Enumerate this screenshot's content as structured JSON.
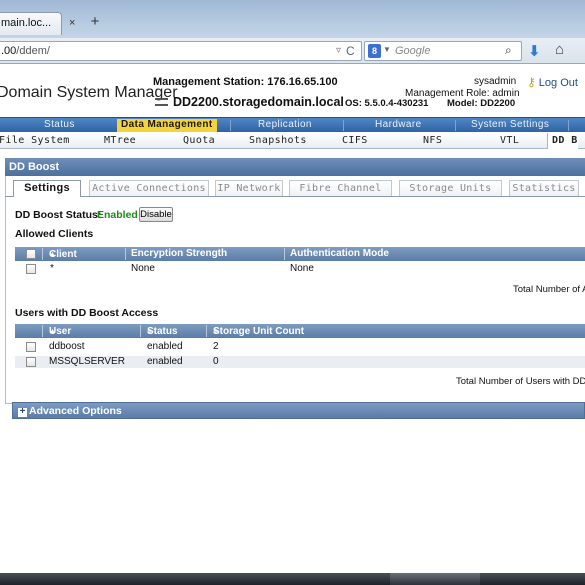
{
  "browser": {
    "tab_title": "main.loc...",
    "tab_close": "×",
    "new_tab": "+",
    "url_host": ".00",
    "url_path": "/ddem/",
    "url_arrow": "▿",
    "reload": "C",
    "search_engine_letter": "8",
    "search_placeholder": "Google",
    "search_go": "⌕",
    "download_icon": "⬇",
    "home_icon": "⌂"
  },
  "header": {
    "app_title": "Domain System Manager",
    "management_station": "Management Station: 176.16.65.100",
    "hostname": "DD2200.storagedomain.local",
    "os": "OS: 5.5.0.4-430231",
    "model": "Model: DD2200",
    "user": "sysadmin",
    "role": "Management Role: admin",
    "logout": "Log Out"
  },
  "main_nav": {
    "items": [
      "Status",
      "Data Management",
      "Replication",
      "Hardware",
      "System Settings"
    ],
    "active": "Data Management"
  },
  "sub_nav": {
    "items": [
      "File System",
      "MTree",
      "Quota",
      "Snapshots",
      "CIFS",
      "NFS",
      "VTL",
      "DD B"
    ],
    "active": "DD B"
  },
  "section": {
    "title": "DD Boost"
  },
  "content_tabs": {
    "items": [
      "Settings",
      "Active Connections",
      "IP Network",
      "Fibre Channel",
      "Storage Units",
      "Statistics"
    ],
    "active": "Settings"
  },
  "settings": {
    "status_label": "DD Boost Status:",
    "status_value": "Enabled",
    "disable_button": "Disable",
    "allowed_clients_heading": "Allowed Clients",
    "clients_columns": [
      "Client",
      "Encryption Strength",
      "Authentication Mode"
    ],
    "clients_sort_indicator": "▲",
    "clients_rows": [
      {
        "client": "*",
        "encryption": "None",
        "auth": "None"
      }
    ],
    "clients_total": "Total Number of A",
    "users_heading": "Users with DD Boost Access",
    "users_columns": [
      "User",
      "Status",
      "Storage Unit Count"
    ],
    "users_sort_indicator": "▲",
    "users_sort_both": "◆",
    "users_rows": [
      {
        "user": "ddboost",
        "status": "enabled",
        "count": "2"
      },
      {
        "user": "MSSQLSERVER",
        "status": "enabled",
        "count": "0"
      }
    ],
    "users_total": "Total Number of Users with DD",
    "advanced_options": "Advanced Options",
    "advanced_plus": "+"
  },
  "colors": {
    "nav_blue": "#2f64a5",
    "active_tab_yellow": "#f5d33a",
    "enabled_green": "#1e8a1e",
    "section_bar": "#5a7ba8"
  }
}
